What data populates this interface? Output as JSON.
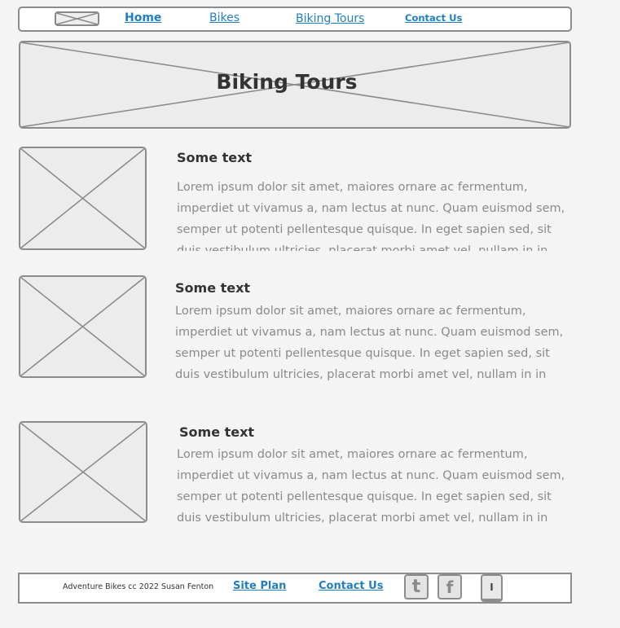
{
  "nav": {
    "links": [
      {
        "label": "Home"
      },
      {
        "label": "Bikes"
      },
      {
        "label": "Biking Tours"
      },
      {
        "label": "Contact Us"
      }
    ]
  },
  "hero": {
    "title": "Biking Tours"
  },
  "cards": [
    {
      "title": "Some text",
      "body": "Lorem ipsum dolor sit amet, maiores ornare ac fermentum, imperdiet ut vivamus a, nam lectus at nunc. Quam euismod sem, semper ut potenti pellentesque quisque. In eget sapien sed, sit duis vestibulum ultricies, placerat morbi amet vel, nullam in in lorem"
    },
    {
      "title": "Some text",
      "body": "Lorem ipsum dolor sit amet, maiores ornare ac fermentum, imperdiet ut vivamus a, nam lectus at nunc. Quam euismod sem, semper ut potenti pellentesque quisque. In eget sapien sed, sit duis vestibulum ultricies, placerat morbi amet vel, nullam in in lorem"
    },
    {
      "title": "Some text",
      "body": "Lorem ipsum dolor sit amet, maiores ornare ac fermentum, imperdiet ut vivamus a, nam lectus at nunc. Quam euismod sem, semper ut potenti pellentesque quisque. In eget sapien sed, sit duis vestibulum ultricies, placerat morbi amet vel, nullam in in lorem"
    }
  ],
  "footer": {
    "copyright": "Adventure Bikes cc 2022 Susan Fenton",
    "site_plan": "Site Plan",
    "contact": "Contact Us",
    "social": [
      {
        "icon": "twitter-icon",
        "glyph": "t"
      },
      {
        "icon": "facebook-icon",
        "glyph": "f"
      }
    ],
    "scroll_button_label": "I"
  },
  "colors": {
    "link": "#1f7fc0",
    "border": "#8c8c8c",
    "placeholder_fill": "#ececec",
    "body_text": "#8a8a8a"
  }
}
